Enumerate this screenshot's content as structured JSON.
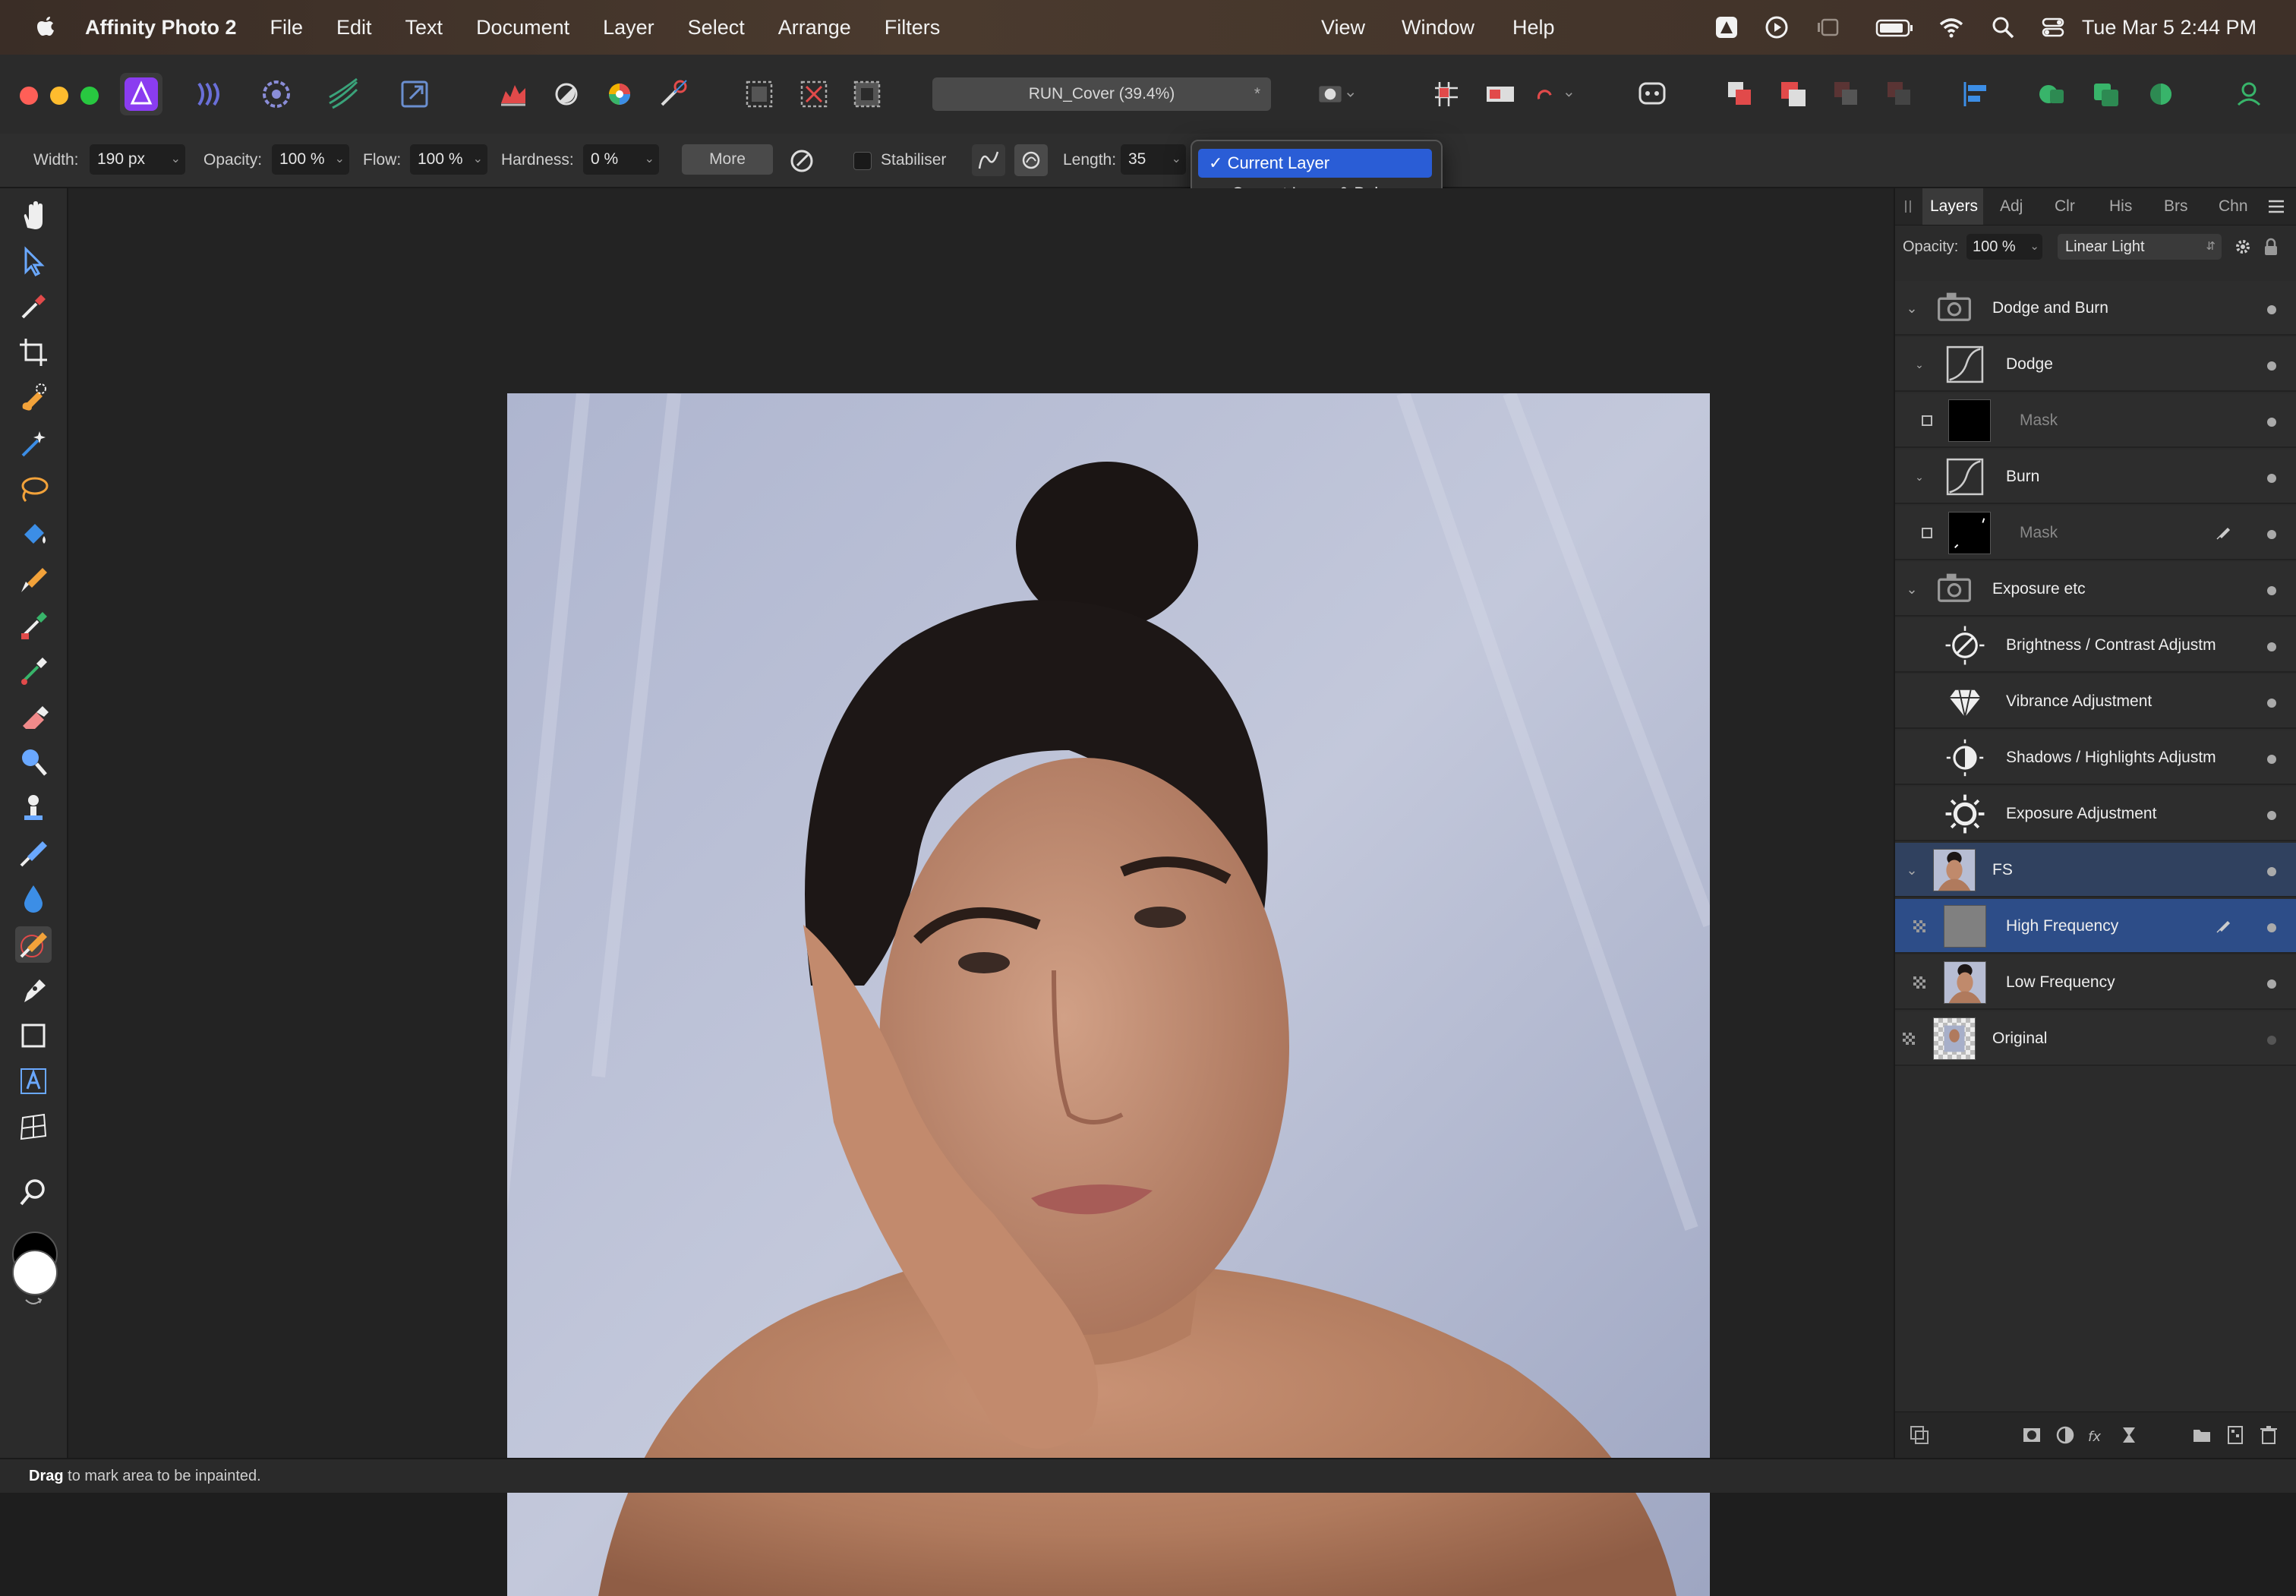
{
  "menubar": {
    "app_name": "Affinity Photo 2",
    "items": [
      "File",
      "Edit",
      "Text",
      "Document",
      "Layer",
      "Select",
      "Arrange",
      "Filters"
    ],
    "right_items": [
      "View",
      "Window",
      "Help"
    ],
    "clock": "Tue Mar 5  2:44 PM"
  },
  "toolbar": {
    "document_title": "RUN_Cover (39.4%)",
    "modified_mark": "*"
  },
  "context_toolbar": {
    "width_label": "Width:",
    "width_value": "190 px",
    "opacity_label": "Opacity:",
    "opacity_value": "100 %",
    "flow_label": "Flow:",
    "flow_value": "100 %",
    "hardness_label": "Hardness:",
    "hardness_value": "0 %",
    "more_label": "More",
    "stabiliser_label": "Stabiliser",
    "length_label": "Length:",
    "length_value": "35"
  },
  "source_dropdown": {
    "options": [
      "Current Layer",
      "Current Layer & Below"
    ],
    "selected_index": 0,
    "check": "✓"
  },
  "layers_panel": {
    "tabs": [
      "Layers",
      "Adj",
      "Clr",
      "His",
      "Brs",
      "Chn"
    ],
    "active_tab": "Layers",
    "opacity_label": "Opacity:",
    "opacity_value": "100 %",
    "blend_mode": "Linear Light",
    "layers": [
      {
        "name": "Dodge and Burn",
        "kind": "group",
        "depth": 0,
        "expanded": true
      },
      {
        "name": "Dodge",
        "kind": "curves",
        "depth": 1
      },
      {
        "name": "Mask",
        "kind": "mask",
        "depth": 2
      },
      {
        "name": "Burn",
        "kind": "curves",
        "depth": 1
      },
      {
        "name": "Mask",
        "kind": "mask-painted",
        "depth": 2
      },
      {
        "name": "Exposure etc",
        "kind": "group",
        "depth": 0,
        "expanded": true
      },
      {
        "name": "Brightness / Contrast Adjustm",
        "kind": "brightness-contrast",
        "depth": 1
      },
      {
        "name": "Vibrance Adjustment",
        "kind": "vibrance",
        "depth": 1
      },
      {
        "name": "Shadows / Highlights Adjustm",
        "kind": "shadows-highlights",
        "depth": 1
      },
      {
        "name": "Exposure Adjustment",
        "kind": "exposure",
        "depth": 1
      },
      {
        "name": "FS",
        "kind": "group-pixel",
        "depth": 0,
        "expanded": true
      },
      {
        "name": "High Frequency",
        "kind": "pixel-grey",
        "depth": 1,
        "selected": true
      },
      {
        "name": "Low Frequency",
        "kind": "pixel-photo",
        "depth": 1
      },
      {
        "name": "Original",
        "kind": "pixel-transparent",
        "depth": 0,
        "hidden": true
      }
    ]
  },
  "statusbar": {
    "bold": "Drag",
    "text": " to mark area to be inpainted."
  },
  "colors": {
    "accent": "#2a5dd6",
    "selected_layer": "#2d4d88",
    "primary_color": "#000000",
    "secondary_color": "#ffffff"
  }
}
